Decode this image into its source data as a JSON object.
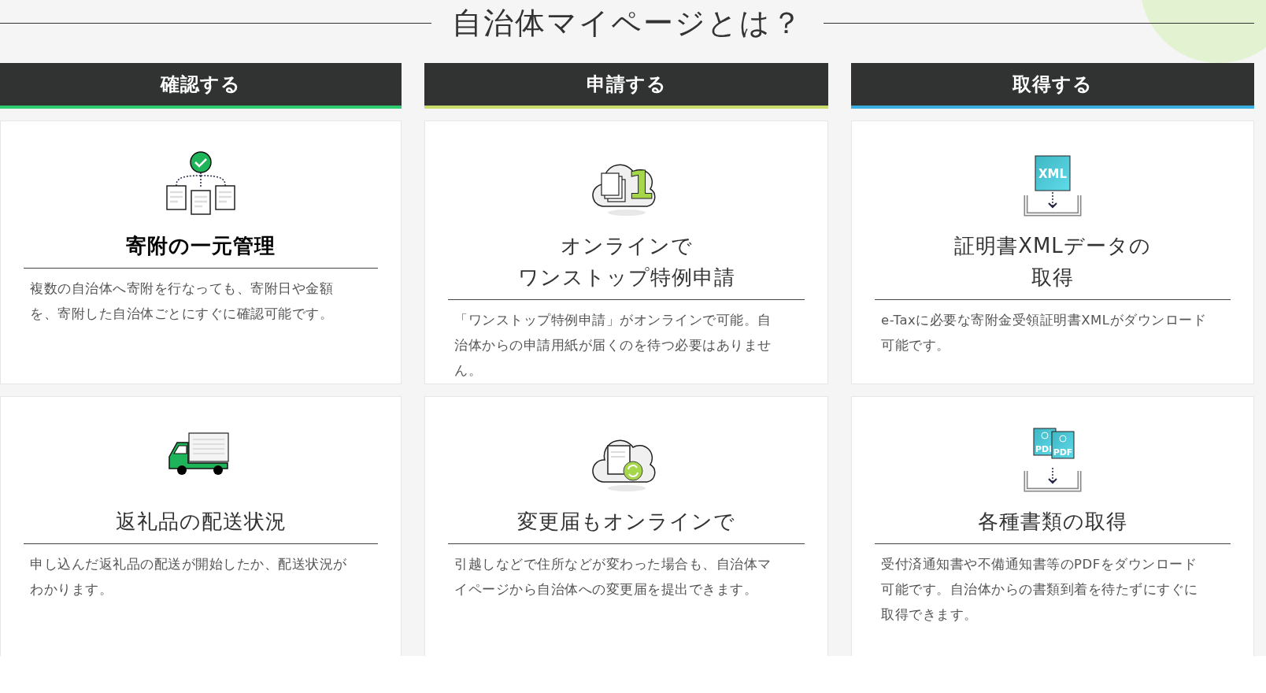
{
  "title": "自治体マイページとは？",
  "columns": [
    {
      "header": {
        "label": "確認する",
        "color": "#2ecc71"
      },
      "cards": [
        {
          "kind": "flow",
          "heading": [
            "寄附の一元管理"
          ],
          "bold": true,
          "body": "複数の自治体へ寄附を行なっても、寄附日や金額を、寄附した自治体ごとにすぐに確認可能です。"
        },
        {
          "kind": "truck",
          "heading": [
            "返礼品の配送状況"
          ],
          "bold": false,
          "body": "申し込んだ返礼品の配送が開始したか、配送状況がわかります。"
        }
      ]
    },
    {
      "header": {
        "label": "申請する",
        "color": "#c8dc6e"
      },
      "cards": [
        {
          "kind": "cloud-number",
          "icon_text": [
            "1"
          ],
          "heading": [
            "オンラインで",
            "ワンストップ特例申請"
          ],
          "bold": false,
          "body": "「ワンストップ特例申請」がオンラインで可能。自治体からの申請用紙が届くのを待つ必要はありません。"
        },
        {
          "kind": "cloud-sync",
          "heading": [
            "変更届もオンラインで"
          ],
          "bold": false,
          "body": "引越しなどで住所などが変わった場合も、自治体マイページから自治体への変更届を提出できます。"
        }
      ]
    },
    {
      "header": {
        "label": "取得する",
        "color": "#3aaee0"
      },
      "cards": [
        {
          "kind": "xml",
          "icon_text": [
            "XML"
          ],
          "heading": [
            "証明書XMLデータの",
            "取得"
          ],
          "bold": false,
          "body": "e-Taxに必要な寄附金受領証明書XMLがダウンロード可能です。"
        },
        {
          "kind": "pdf",
          "icon_text": [
            "PDI",
            "PDF"
          ],
          "heading": [
            "各種書類の取得"
          ],
          "bold": false,
          "body": "受付済通知書や不備通知書等のPDFをダウンロード可能です。自治体からの書類到着を待たずにすぐに取得できます。"
        }
      ]
    }
  ]
}
